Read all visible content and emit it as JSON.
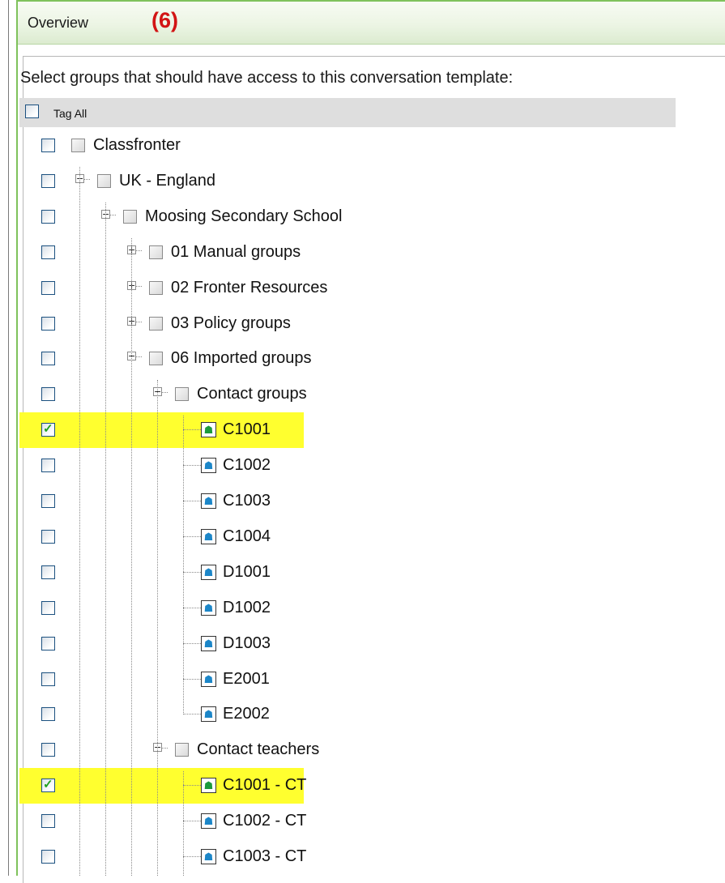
{
  "header": {
    "title": "Overview",
    "badge": "(6)"
  },
  "intro": "Select groups that should have access to this conversation template:",
  "tag_all": {
    "label": "Tag All",
    "checked": false
  },
  "rows": [
    {
      "label": "Classfronter",
      "depth": 0,
      "expander": null,
      "icon": "checkbox",
      "checked": false,
      "highlighted": false
    },
    {
      "label": "UK - England",
      "depth": 1,
      "expander": "minus",
      "icon": "checkbox",
      "checked": false,
      "highlighted": false
    },
    {
      "label": "Moosing Secondary School",
      "depth": 2,
      "expander": "minus",
      "icon": "checkbox",
      "checked": false,
      "highlighted": false
    },
    {
      "label": "01 Manual groups",
      "depth": 3,
      "expander": "plus",
      "icon": "checkbox",
      "checked": false,
      "highlighted": false
    },
    {
      "label": "02 Fronter Resources",
      "depth": 3,
      "expander": "plus",
      "icon": "checkbox",
      "checked": false,
      "highlighted": false
    },
    {
      "label": "03 Policy groups",
      "depth": 3,
      "expander": "plus",
      "icon": "checkbox",
      "checked": false,
      "highlighted": false
    },
    {
      "label": "06 Imported groups",
      "depth": 3,
      "expander": "minus",
      "icon": "checkbox",
      "checked": false,
      "highlighted": false
    },
    {
      "label": "Contact groups",
      "depth": 4,
      "expander": "minus",
      "icon": "checkbox",
      "checked": false,
      "highlighted": false
    },
    {
      "label": "C1001",
      "depth": 5,
      "expander": null,
      "icon": "group-icon",
      "checked": true,
      "highlighted": true
    },
    {
      "label": "C1002",
      "depth": 5,
      "expander": null,
      "icon": "group-icon",
      "checked": false,
      "highlighted": false
    },
    {
      "label": "C1003",
      "depth": 5,
      "expander": null,
      "icon": "group-icon",
      "checked": false,
      "highlighted": false
    },
    {
      "label": "C1004",
      "depth": 5,
      "expander": null,
      "icon": "group-icon",
      "checked": false,
      "highlighted": false
    },
    {
      "label": "D1001",
      "depth": 5,
      "expander": null,
      "icon": "group-icon",
      "checked": false,
      "highlighted": false
    },
    {
      "label": "D1002",
      "depth": 5,
      "expander": null,
      "icon": "group-icon",
      "checked": false,
      "highlighted": false
    },
    {
      "label": "D1003",
      "depth": 5,
      "expander": null,
      "icon": "group-icon",
      "checked": false,
      "highlighted": false
    },
    {
      "label": "E2001",
      "depth": 5,
      "expander": null,
      "icon": "group-icon",
      "checked": false,
      "highlighted": false
    },
    {
      "label": "E2002",
      "depth": 5,
      "expander": null,
      "icon": "group-icon",
      "checked": false,
      "highlighted": false
    },
    {
      "label": "Contact teachers",
      "depth": 4,
      "expander": "minus",
      "icon": "checkbox",
      "checked": false,
      "highlighted": false
    },
    {
      "label": "C1001 - CT",
      "depth": 5,
      "expander": null,
      "icon": "group-icon",
      "checked": true,
      "highlighted": true
    },
    {
      "label": "C1002 - CT",
      "depth": 5,
      "expander": null,
      "icon": "group-icon",
      "checked": false,
      "highlighted": false
    },
    {
      "label": "C1003 - CT",
      "depth": 5,
      "expander": null,
      "icon": "group-icon",
      "checked": false,
      "highlighted": false
    }
  ],
  "colors": {
    "highlight": "#ffff2f",
    "frame_green": "#7fc25c",
    "badge_red": "#d21414",
    "check_green": "#21a121"
  }
}
